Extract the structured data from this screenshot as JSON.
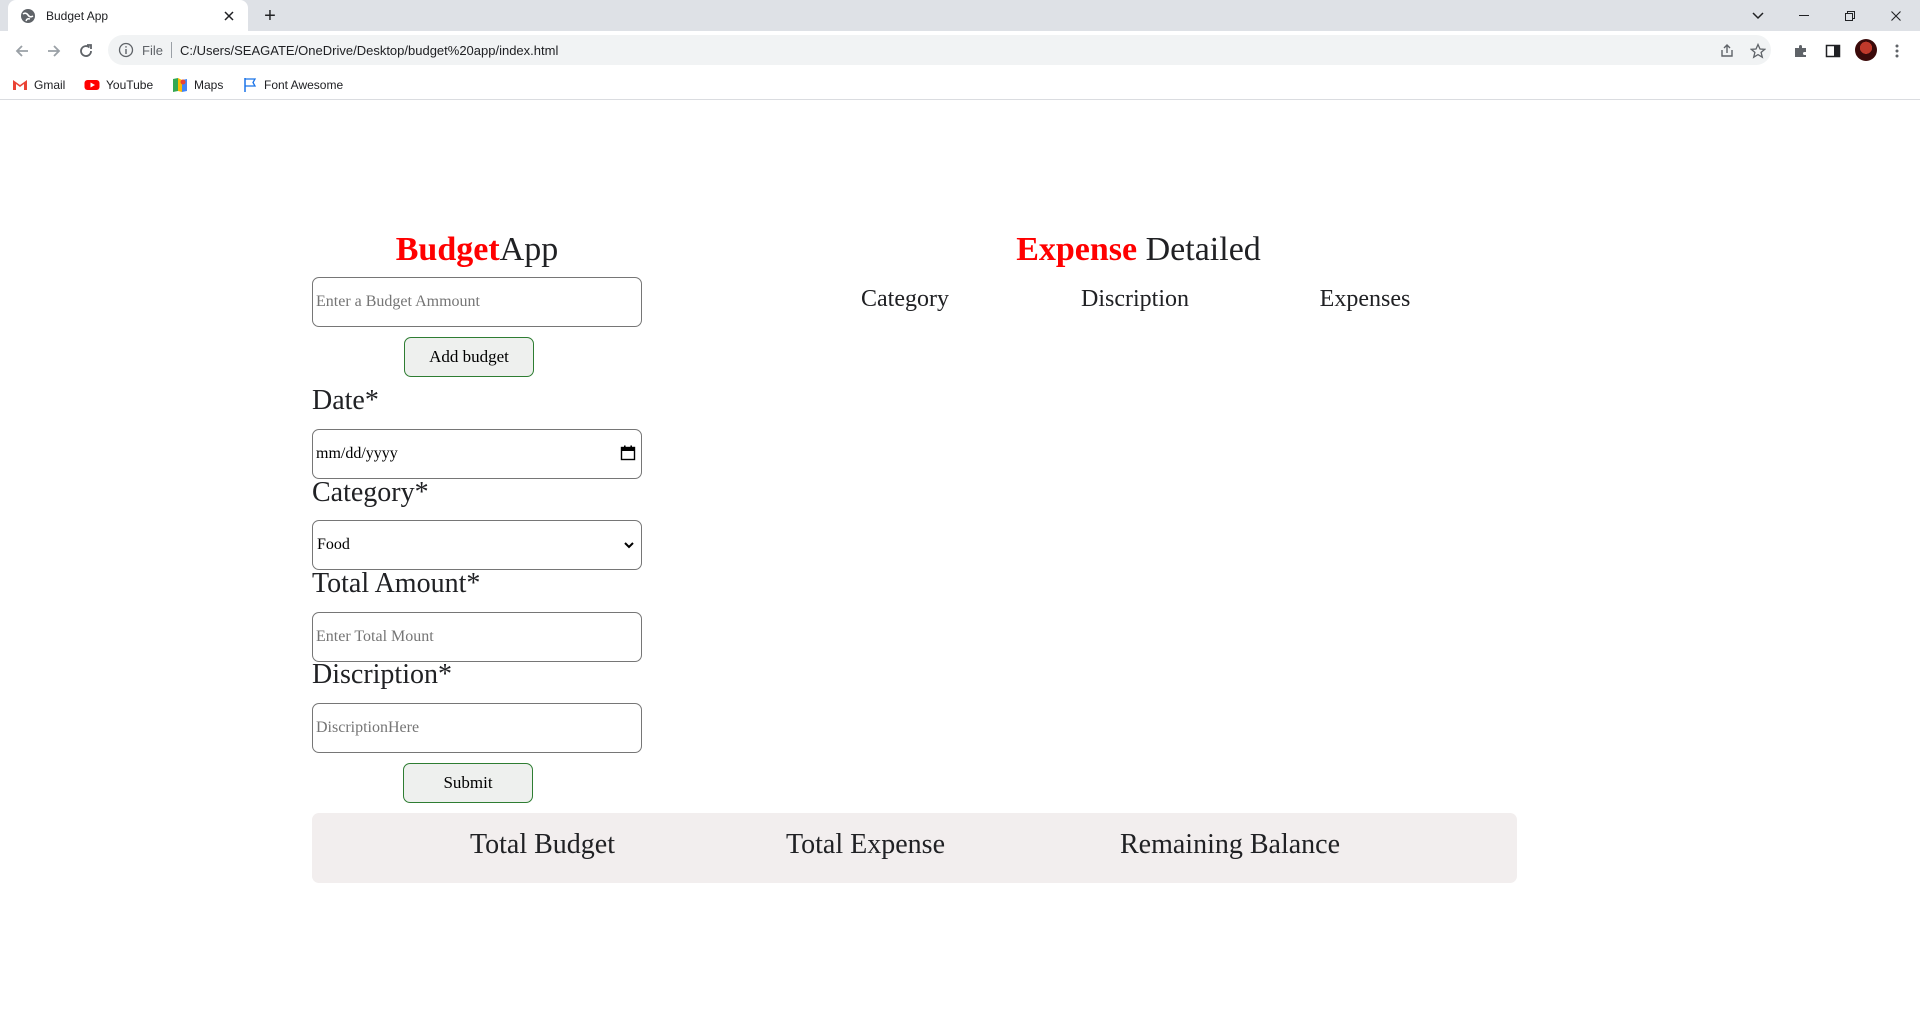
{
  "browser": {
    "tab_title": "Budget App",
    "new_tab": "+",
    "omnibox": {
      "scheme_label": "File",
      "url": "C:/Users/SEAGATE/OneDrive/Desktop/budget%20app/index.html"
    },
    "bookmarks": [
      {
        "label": "Gmail"
      },
      {
        "label": "YouTube"
      },
      {
        "label": "Maps"
      },
      {
        "label": "Font Awesome"
      }
    ]
  },
  "app": {
    "title_bold": "Budget",
    "title_rest": "App",
    "budget_input_placeholder": "Enter a Budget Ammount",
    "add_budget_label": "Add budget",
    "date_label": "Date*",
    "date_placeholder": "mm/dd/yyyy",
    "category_label": "Category*",
    "category_selected": "Food",
    "amount_label": "Total Amount*",
    "amount_placeholder": "Enter Total Mount",
    "description_label": "Discription*",
    "description_placeholder": "DiscriptionHere",
    "submit_label": "Submit"
  },
  "expenses": {
    "title_bold": "Expense",
    "title_rest": " Detailed",
    "columns": [
      "Category",
      "Discription",
      "Expenses"
    ]
  },
  "summary": {
    "total_budget": "Total Budget",
    "total_expense": "Total Expense",
    "remaining_balance": "Remaining Balance"
  },
  "colors": {
    "accent_red": "#ff0000",
    "button_border": "#2e7d32",
    "summary_bg": "#f2eeee"
  }
}
